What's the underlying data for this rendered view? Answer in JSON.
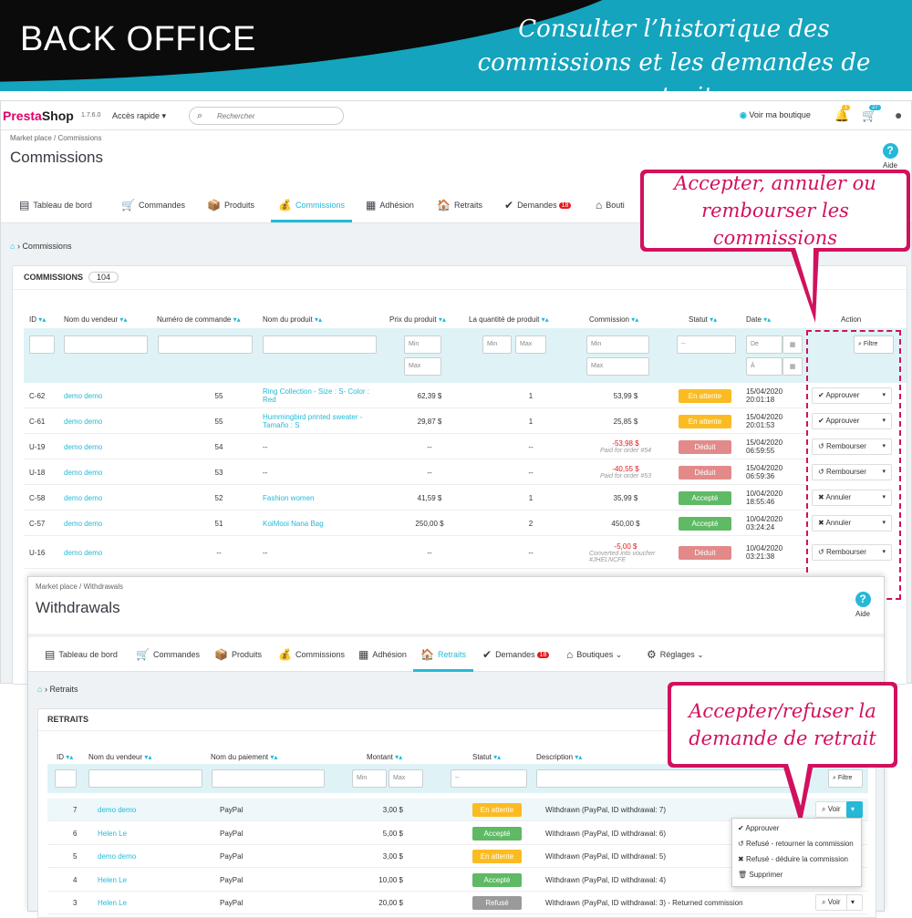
{
  "banner": {
    "title": "BACK OFFICE",
    "subtitle": "Consulter l’historique des commissions et les demandes de retrait"
  },
  "topbar": {
    "logo_a": "Presta",
    "logo_b": "Shop",
    "version": "1.7.6.0",
    "quick_access": "Accès rapide ▾",
    "search_placeholder": "Rechercher",
    "view_shop": "Voir ma boutique",
    "bell_count": "1",
    "cart_count": "27"
  },
  "page1": {
    "breadcrumb": "Market place / Commissions",
    "title": "Commissions",
    "help": "Aide",
    "crumb2": "Commissions",
    "tabs": [
      "Tableau de bord",
      "Commandes",
      "Produits",
      "Commissions",
      "Adhésion",
      "Retraits",
      "Demandes",
      "Bouti"
    ],
    "tab_badge": "18",
    "panel_title": "COMMISSIONS",
    "panel_count": "104",
    "headers": [
      "ID",
      "Nom du vendeur",
      "Numéro de commande",
      "Nom du produit",
      "Prix du produit",
      "La quantité de produit",
      "Commission",
      "Statut",
      "Date",
      "Action"
    ],
    "filter": {
      "min": "Min",
      "max": "Max",
      "de": "De",
      "a": "À",
      "select": "--",
      "btn": "Filtre"
    },
    "rows": [
      {
        "id": "C-62",
        "vendor": "demo demo",
        "order": "55",
        "product": "Ring Collection - Size : S- Color : Red",
        "price": "62,39 $",
        "qty": "1",
        "commission": "53,99 $",
        "note": "",
        "status": "En attente",
        "cls": "att",
        "date": "15/04/2020 20:01:18",
        "action": "Approuver"
      },
      {
        "id": "C-61",
        "vendor": "demo demo",
        "order": "55",
        "product": "Hummingbird printed sweater - Tamaño : S",
        "price": "29,87 $",
        "qty": "1",
        "commission": "25,85 $",
        "note": "",
        "status": "En attente",
        "cls": "att",
        "date": "15/04/2020 20:01:53",
        "action": "Approuver"
      },
      {
        "id": "U-19",
        "vendor": "demo demo",
        "order": "54",
        "product": "--",
        "price": "--",
        "qty": "--",
        "commission": "-53,98 $",
        "note": "Paid for order #54",
        "status": "Déduit",
        "cls": "ded",
        "date": "15/04/2020 06:59:55",
        "action": "Rembourser"
      },
      {
        "id": "U-18",
        "vendor": "demo demo",
        "order": "53",
        "product": "--",
        "price": "--",
        "qty": "--",
        "commission": "-40,55 $",
        "note": "Paid for order #53",
        "status": "Déduit",
        "cls": "ded",
        "date": "15/04/2020 06:59:36",
        "action": "Rembourser"
      },
      {
        "id": "C-58",
        "vendor": "demo demo",
        "order": "52",
        "product": "Fashion women",
        "price": "41,59 $",
        "qty": "1",
        "commission": "35,99 $",
        "note": "",
        "status": "Accepté",
        "cls": "acc",
        "date": "10/04/2020 18:55:46",
        "action": "Annuler"
      },
      {
        "id": "C-57",
        "vendor": "demo demo",
        "order": "51",
        "product": "KoiMooi Nana Bag",
        "price": "250,00 $",
        "qty": "2",
        "commission": "450,00 $",
        "note": "",
        "status": "Accepté",
        "cls": "acc",
        "date": "10/04/2020 03:24:24",
        "action": "Annuler"
      },
      {
        "id": "U-16",
        "vendor": "demo demo",
        "order": "--",
        "product": "--",
        "price": "--",
        "qty": "--",
        "commission": "-5,00 $",
        "note": "Converted into voucher #JHELNCFE",
        "status": "Déduit",
        "cls": "ded",
        "date": "10/04/2020 03:21:38",
        "action": "Rembourser"
      }
    ]
  },
  "callout1": "Accepter, annuler ou rembourser les commissions",
  "callout2": "Accepter/refuser la demande de retrait",
  "page2": {
    "breadcrumb": "Market place / Withdrawals",
    "title": "Withdrawals",
    "help": "Aide",
    "crumb2": "Retraits",
    "tabs": [
      "Tableau de bord",
      "Commandes",
      "Produits",
      "Commissions",
      "Adhésion",
      "Retraits",
      "Demandes",
      "Boutiques ⌄",
      "Réglages ⌄"
    ],
    "tab_badge": "18",
    "panel_title": "RETRAITS",
    "headers": [
      "ID",
      "Nom du vendeur",
      "Nom du paiement",
      "Montant",
      "Statut",
      "Description"
    ],
    "filter": {
      "min": "Min",
      "max": "Max",
      "select": "--",
      "btn": "Filtre"
    },
    "rows": [
      {
        "id": "7",
        "vendor": "demo demo",
        "pay": "PayPal",
        "amount": "3,00 $",
        "status": "En attente",
        "cls": "att",
        "desc": "Withdrawn (PayPal, ID withdrawal: 7)",
        "action": "Voir"
      },
      {
        "id": "6",
        "vendor": "Helen Le",
        "pay": "PayPal",
        "amount": "5,00 $",
        "status": "Accepté",
        "cls": "acc",
        "desc": "Withdrawn (PayPal, ID withdrawal: 6)",
        "action": ""
      },
      {
        "id": "5",
        "vendor": "demo demo",
        "pay": "PayPal",
        "amount": "3,00 $",
        "status": "En attente",
        "cls": "att",
        "desc": "Withdrawn (PayPal, ID withdrawal: 5)",
        "action": ""
      },
      {
        "id": "4",
        "vendor": "Helen Le",
        "pay": "PayPal",
        "amount": "10,00 $",
        "status": "Accepté",
        "cls": "acc",
        "desc": "Withdrawn (PayPal, ID withdrawal: 4)",
        "action": ""
      },
      {
        "id": "3",
        "vendor": "Helen Le",
        "pay": "PayPal",
        "amount": "20,00 $",
        "status": "Refusé",
        "cls": "ref",
        "desc": "Withdrawn (PayPal, ID withdrawal: 3) - Returned commission",
        "action": "Voir"
      }
    ],
    "menu": [
      "Approuver",
      "Refusé - retourner la commission",
      "Refusé - déduire la commission",
      "Supprimer"
    ]
  },
  "colors": {
    "accent": "#25b9d7",
    "brand": "#df0067",
    "callout": "#d1115e"
  }
}
